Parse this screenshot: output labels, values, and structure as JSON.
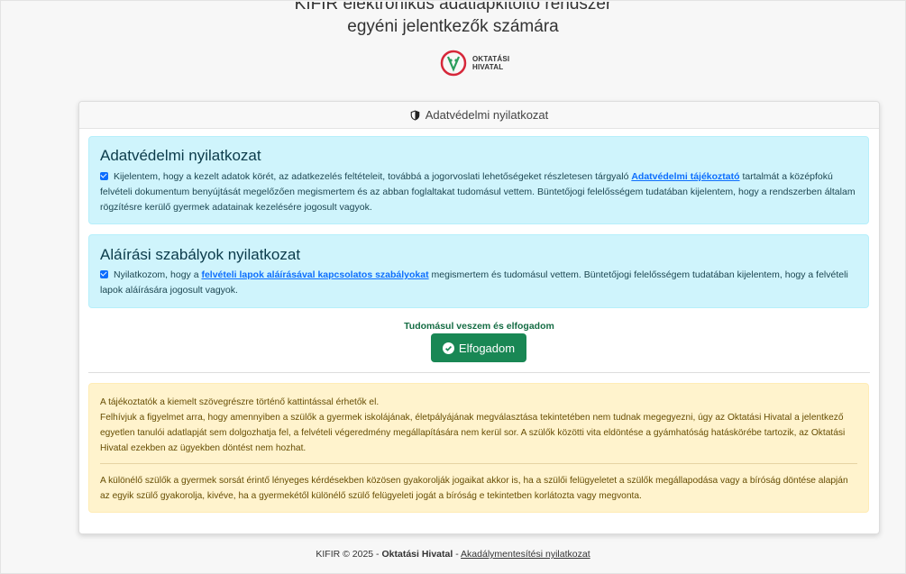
{
  "header": {
    "title_line1": "KIFIR elektronikus adatlapkitöltő rendszer",
    "title_line2": "egyéni jelentkezők számára",
    "logo_text_1": "OKTATÁSI",
    "logo_text_2": "HIVATAL"
  },
  "card": {
    "header_title": "Adatvédelmi nyilatkozat",
    "privacy": {
      "title": "Adatvédelmi nyilatkozat",
      "checked": true,
      "text_before": "Kijelentem, hogy a kezelt adatok körét, az adatkezelés feltételeit, továbbá a jogorvoslati lehetőségeket részletesen tárgyaló ",
      "link_text": "Adatvédelmi tájékoztató",
      "text_after": " tartalmát a középfokú felvételi dokumentum benyújtását megelőzően megismertem és az abban foglaltakat tudomásul vettem. Büntetőjogi felelősségem tudatában kijelentem, hogy a rendszerben általam rögzítésre kerülő gyermek adatainak kezelésére jogosult vagyok."
    },
    "signature": {
      "title": "Aláírási szabályok nyilatkozat",
      "checked": true,
      "text_before": "Nyilatkozom, hogy a ",
      "link_text": "felvételi lapok aláírásával kapcsolatos szabályokat",
      "text_after": " megismertem és tudomásul vettem. Büntetőjogi felelősségem tudatában kijelentem, hogy a felvételi lapok aláírására jogosult vagyok."
    },
    "accept_label": "Tudomásul veszem és elfogadom",
    "accept_button": "Elfogadom",
    "info": {
      "paragraph1_line1": "A tájékoztatók a kiemelt szövegrészre történő kattintással érhetők el.",
      "paragraph1_rest": "Felhívjuk a figyelmet arra, hogy amennyiben a szülők a gyermek iskolájának, életpályájának megválasztása tekintetében nem tudnak megegyezni, úgy az Oktatási Hivatal a jelentkező egyetlen tanulói adatlapját sem dolgozhatja fel, a felvételi végeredmény megállapítására nem kerül sor. A szülők közötti vita eldöntése a gyámhatóság hatáskörébe tartozik, az Oktatási Hivatal ezekben az ügyekben döntést nem hozhat.",
      "paragraph2": "A különélő szülők a gyermek sorsát érintő lényeges kérdésekben közösen gyakorolják jogaikat akkor is, ha a szülői felügyeletet a szülők megállapodása vagy a bíróság döntése alapján az egyik szülő gyakorolja, kivéve, ha a gyermekétől különélő szülő felügyeleti jogát a bíróság e tekintetben korlátozta vagy megvonta."
    }
  },
  "footer": {
    "prefix": "KIFIR © 2025 - ",
    "org": "Oktatási Hivatal",
    "separator": " - ",
    "link": "Akadálymentesítési nyilatkozat"
  },
  "colors": {
    "info_bg": "#cff4fc",
    "warn_bg": "#fff3cd",
    "accept_green": "#198754",
    "link_blue": "#0d6efd"
  }
}
